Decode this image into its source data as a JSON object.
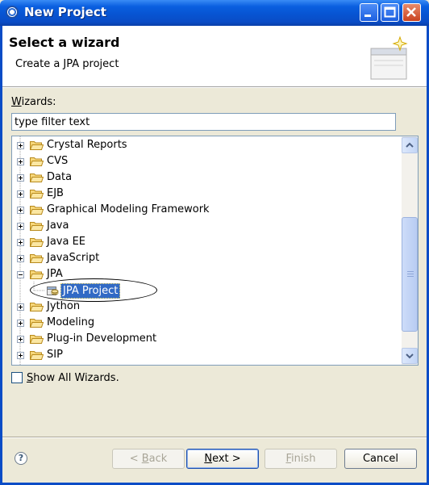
{
  "window": {
    "title": "New Project"
  },
  "banner": {
    "title": "Select a wizard",
    "description": "Create a JPA project"
  },
  "wizards": {
    "label_prefix": "W",
    "label_rest": "izards:",
    "filter_value": "type filter text"
  },
  "tree": {
    "items": [
      {
        "label": "Crystal Reports",
        "expanded": false
      },
      {
        "label": "CVS",
        "expanded": false
      },
      {
        "label": "Data",
        "expanded": false
      },
      {
        "label": "EJB",
        "expanded": false
      },
      {
        "label": "Graphical Modeling Framework",
        "expanded": false
      },
      {
        "label": "Java",
        "expanded": false
      },
      {
        "label": "Java EE",
        "expanded": false
      },
      {
        "label": "JavaScript",
        "expanded": false
      },
      {
        "label": "JPA",
        "expanded": true
      },
      {
        "label": "JPA Project",
        "selected": true,
        "child": true
      },
      {
        "label": "Jython",
        "expanded": false
      },
      {
        "label": "Modeling",
        "expanded": false
      },
      {
        "label": "Plug-in Development",
        "expanded": false
      },
      {
        "label": "SIP",
        "expanded": false
      }
    ]
  },
  "show_all": {
    "label_prefix": "S",
    "label_rest": "how All Wizards.",
    "checked": false
  },
  "buttons": {
    "back": {
      "prefix": "< ",
      "mnemonic": "B",
      "rest": "ack"
    },
    "next": {
      "prefix": "",
      "mnemonic": "N",
      "rest": "ext >"
    },
    "finish": {
      "prefix": "",
      "mnemonic": "F",
      "rest": "inish"
    },
    "cancel": "Cancel"
  },
  "help": {
    "icon": "help-icon",
    "glyph": "?"
  },
  "colors": {
    "titlebar": "#0754d2",
    "selection": "#316ac5",
    "dialog_bg": "#ece9d8"
  }
}
